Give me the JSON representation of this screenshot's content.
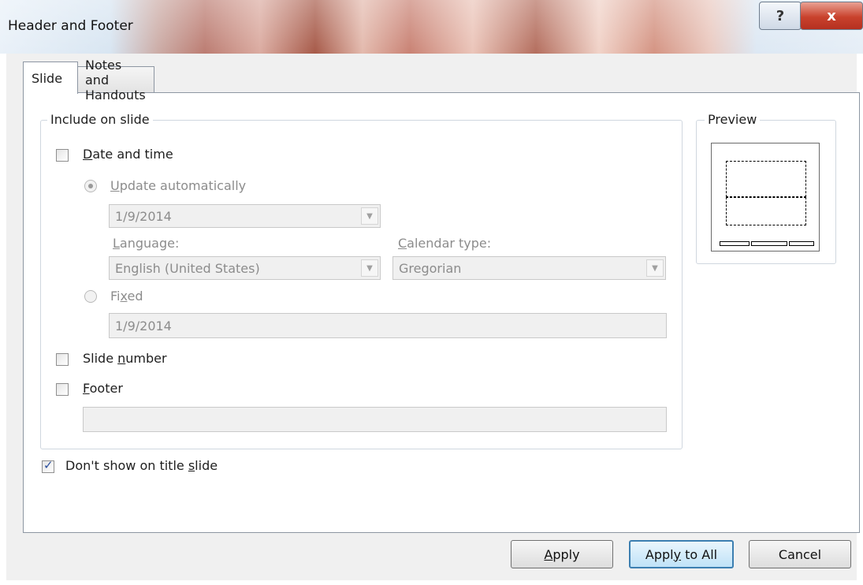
{
  "window": {
    "title": "Header and Footer",
    "help_glyph": "?",
    "close_glyph": "x"
  },
  "tabs": [
    {
      "label": "Slide",
      "active": true
    },
    {
      "label": "Notes and Handouts",
      "active": false
    }
  ],
  "include_group": {
    "legend": "Include on slide",
    "date_time": {
      "label_u": "D",
      "label_rest": "ate and time",
      "checked": false
    },
    "update_auto": {
      "label_u": "U",
      "label_rest": "pdate automatically",
      "selected": true,
      "enabled": false
    },
    "date_combo": {
      "value": "1/9/2014"
    },
    "language": {
      "label_u": "L",
      "label_rest": "anguage:",
      "value": "English (United States)"
    },
    "calendar": {
      "label_u": "C",
      "label_rest": "alendar type:",
      "value": "Gregorian"
    },
    "fixed": {
      "label_pre": "Fi",
      "label_u": "x",
      "label_rest": "ed",
      "selected": false,
      "value": "1/9/2014"
    },
    "slide_number": {
      "label_pre": "Slide ",
      "label_u": "n",
      "label_rest": "umber",
      "checked": false
    },
    "footer": {
      "label_u": "F",
      "label_rest": "ooter",
      "checked": false,
      "value": ""
    }
  },
  "dont_show": {
    "label_pre": "Don't show on title ",
    "label_u": "s",
    "label_rest": "lide",
    "checked": true
  },
  "preview": {
    "legend": "Preview"
  },
  "buttons": {
    "apply": {
      "label_u": "A",
      "label_rest": "pply"
    },
    "apply_all": {
      "label_pre": "Appl",
      "label_u": "y",
      "label_rest": " to All"
    },
    "cancel": {
      "label": "Cancel"
    }
  },
  "colors": {
    "accent": "#3c7fb1",
    "check": "#2a4e9c",
    "disabled_text": "#8c8c8c"
  }
}
